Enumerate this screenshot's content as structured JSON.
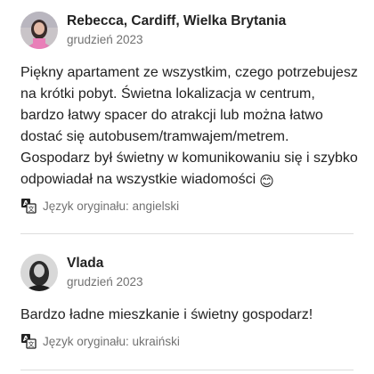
{
  "reviews": [
    {
      "name": "Rebecca, Cardiff, Wielka Brytania",
      "date": "grudzień 2023",
      "text": "Piękny apartament ze wszystkim, czego potrzebujesz na krótki pobyt. Świetna lokalizacja w centrum, bardzo łatwy spacer do atrakcji lub można łatwo dostać się autobusem/tramwajem/metrem. Gospodarz był świetny w komunikowaniu się i szybko odpowiadał na wszystkie wiadomości",
      "emoji": "😊",
      "original_language": "Język oryginału: angielski"
    },
    {
      "name": "Vlada",
      "date": "grudzień 2023",
      "text": "Bardzo ładne mieszkanie i świetny gospodarz!",
      "original_language": "Język oryginału: ukraiński"
    }
  ],
  "icons": {
    "avatar_1": "avatar-photo",
    "avatar_2": "avatar-photo",
    "translate": "translate-icon"
  },
  "colors": {
    "text": "#222222",
    "secondary": "#717171",
    "divider": "#dddddd"
  }
}
